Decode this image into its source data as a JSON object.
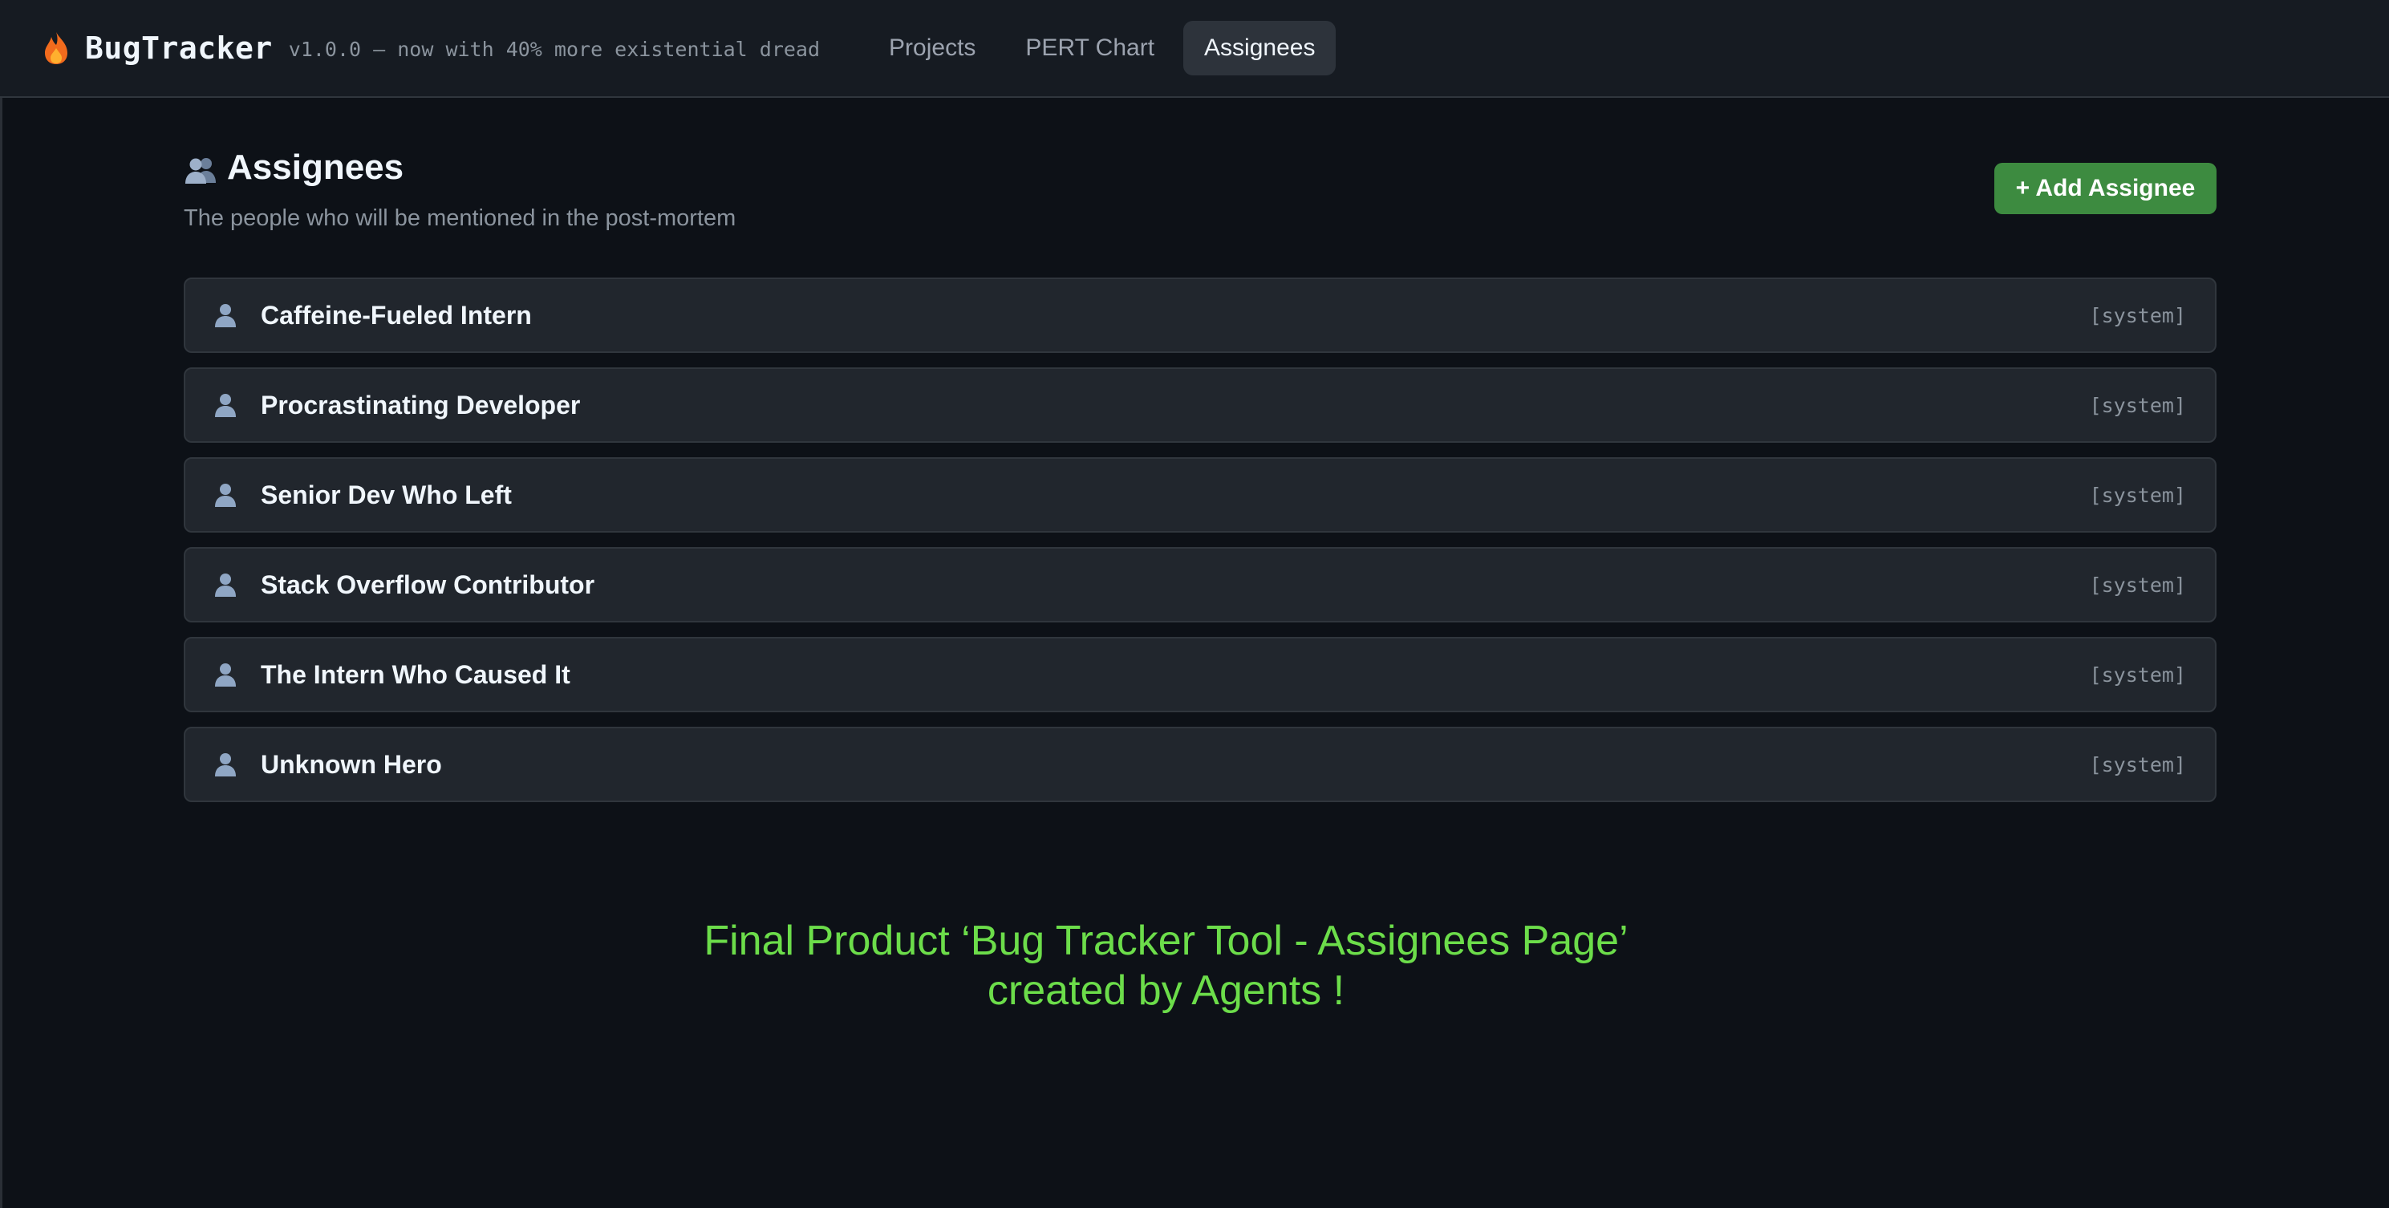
{
  "header": {
    "brand": {
      "icon": "fire-icon",
      "name": "BugTracker",
      "tagline": "v1.0.0 — now with 40% more existential dread"
    },
    "nav": {
      "tabs": [
        {
          "label": "Projects",
          "active": false
        },
        {
          "label": "PERT Chart",
          "active": false
        },
        {
          "label": "Assignees",
          "active": true
        }
      ]
    }
  },
  "page": {
    "title_icon": "users-icon",
    "title": "Assignees",
    "subtitle": "The people who will be mentioned in the post-mortem",
    "add_button_label": "+ Add Assignee"
  },
  "assignees": [
    {
      "icon": "person-icon",
      "name": "Caffeine-Fueled Intern",
      "tag": "[system]"
    },
    {
      "icon": "person-icon",
      "name": "Procrastinating Developer",
      "tag": "[system]"
    },
    {
      "icon": "person-icon",
      "name": "Senior Dev Who Left",
      "tag": "[system]"
    },
    {
      "icon": "person-icon",
      "name": "Stack Overflow Contributor",
      "tag": "[system]"
    },
    {
      "icon": "person-icon",
      "name": "The Intern Who Caused It",
      "tag": "[system]"
    },
    {
      "icon": "person-icon",
      "name": "Unknown Hero",
      "tag": "[system]"
    }
  ],
  "caption": {
    "line1": "Final Product ‘Bug Tracker Tool - Assignees Page’",
    "line2": "created by Agents !"
  },
  "colors": {
    "background": "#0d1117",
    "topbar": "#161b22",
    "card": "#21262d",
    "accent_green_button": "#3d8b40",
    "caption_green": "#6cdd4a"
  }
}
